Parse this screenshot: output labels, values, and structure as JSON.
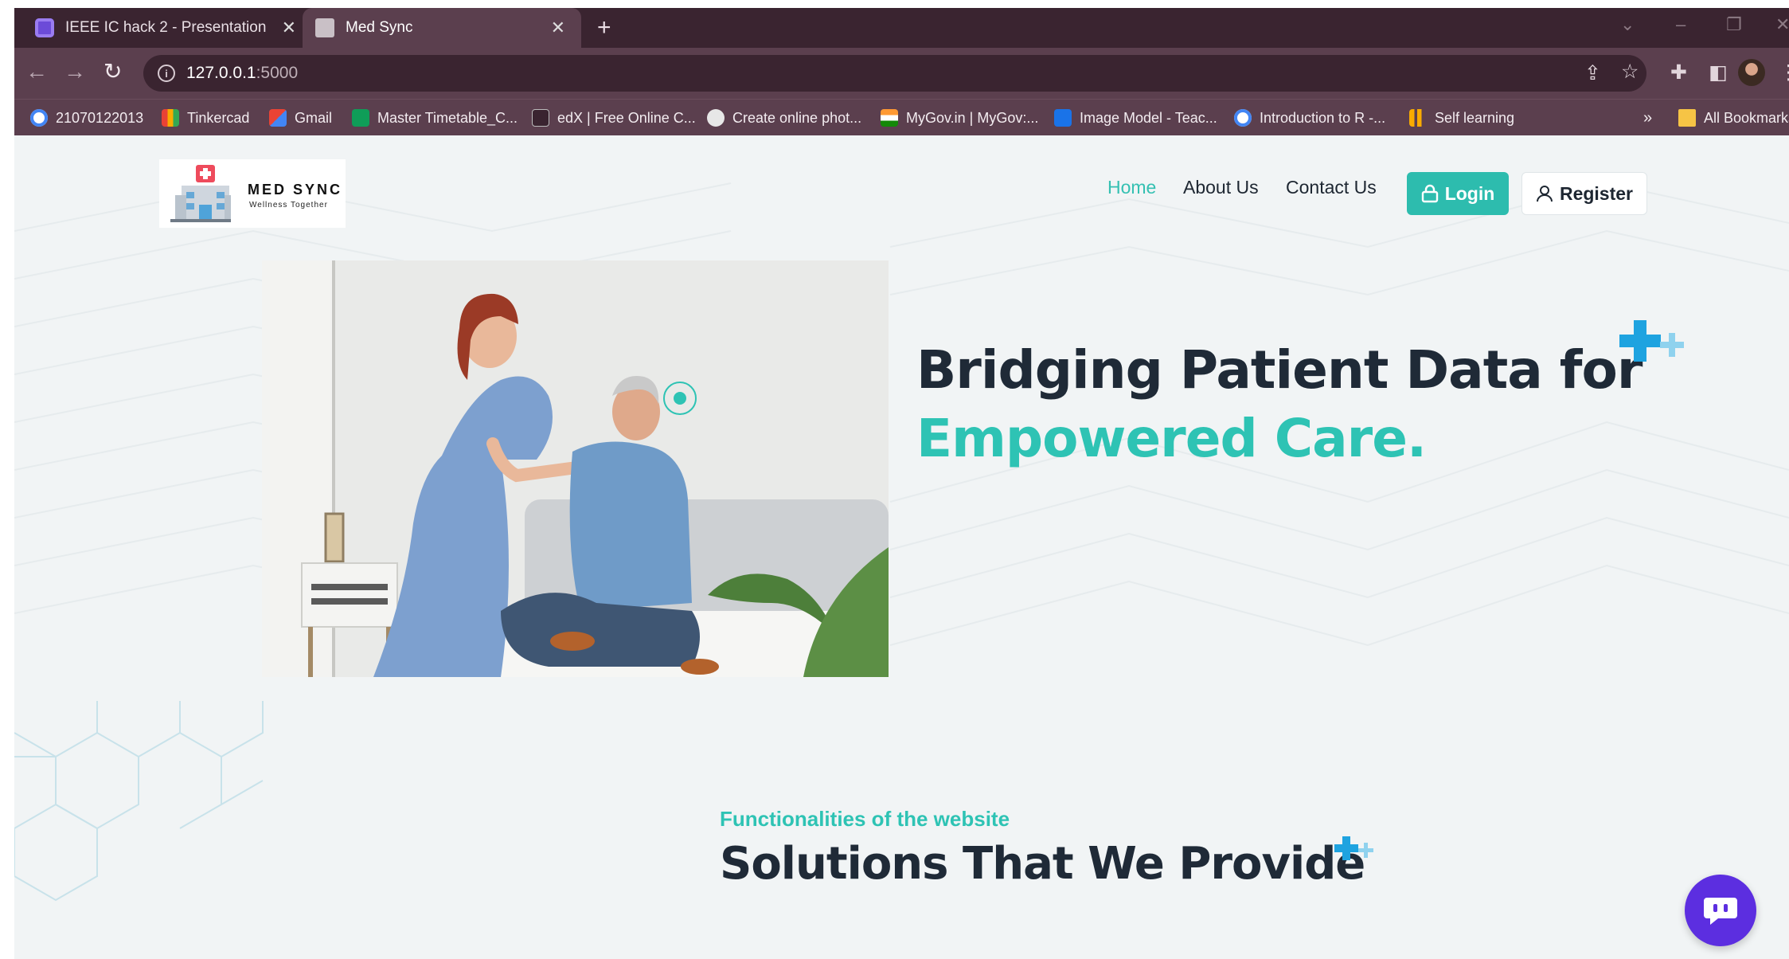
{
  "browser": {
    "tabs": [
      {
        "title": "IEEE IC hack 2 - Presentation",
        "active": false
      },
      {
        "title": "Med Sync",
        "active": true
      }
    ],
    "url": {
      "host": "127.0.0.1",
      "port": ":5000"
    },
    "bookmarks": [
      {
        "label": "21070122013",
        "icon": "google-icon"
      },
      {
        "label": "Tinkercad",
        "icon": "tinkercad-icon"
      },
      {
        "label": "Gmail",
        "icon": "gmail-icon"
      },
      {
        "label": "Master Timetable_C...",
        "icon": "sheets-icon"
      },
      {
        "label": "edX | Free Online C...",
        "icon": "edx-icon"
      },
      {
        "label": "Create online phot...",
        "icon": "globe-icon"
      },
      {
        "label": "MyGov.in | MyGov:...",
        "icon": "mygov-icon"
      },
      {
        "label": "Image Model - Teac...",
        "icon": "tm-icon"
      },
      {
        "label": "Introduction to R -...",
        "icon": "google-icon"
      },
      {
        "label": "Self learning",
        "icon": "bars-icon"
      }
    ],
    "bookmarks_overflow": "»",
    "all_bookmarks": "All Bookmarks"
  },
  "site": {
    "logo": {
      "name": "MED SYNC",
      "tagline": "Wellness Together"
    },
    "nav": {
      "home": "Home",
      "about": "About Us",
      "contact": "Contact Us"
    },
    "login_label": "Login",
    "register_label": "Register",
    "hero": {
      "line1": "Bridging Patient Data for",
      "line2": "Empowered Care."
    },
    "section": {
      "kicker": "Functionalities of the website",
      "title": "Solutions That We Provide"
    }
  },
  "colors": {
    "accent": "#2ec3b4",
    "dark_text": "#1f2a37",
    "plus_blue": "#1ea3e0",
    "chat": "#5c2ee0"
  }
}
